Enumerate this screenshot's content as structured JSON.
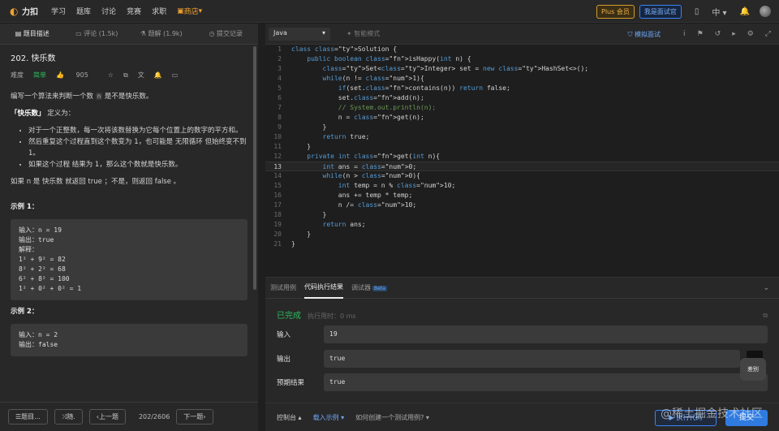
{
  "topbar": {
    "logo": "力扣",
    "nav": [
      "学习",
      "题库",
      "讨论",
      "竞赛",
      "求职"
    ],
    "store": "商店",
    "plus": "Plus 会员",
    "interview": "我是面试官",
    "lang": "中"
  },
  "left": {
    "tabs": [
      "题目描述",
      "评论 (1.5k)",
      "题解 (1.9k)",
      "提交记录"
    ],
    "problem_title": "202. 快乐数",
    "difficulty_label": "难度",
    "difficulty": "简单",
    "likes": "905",
    "desc1_a": "编写一个算法来判断一个数 ",
    "desc1_code": "n",
    "desc1_b": " 是不是快乐数。",
    "def_bold": "「快乐数」",
    "def_rest": " 定义为：",
    "bullets": [
      "对于一个正整数，每一次将该数替换为它每个位置上的数字的平方和。",
      "然后重复这个过程直到这个数变为 1，也可能是 无限循环 但始终变不到 1。",
      "如果这个过程 结果为 1，那么这个数就是快乐数。"
    ],
    "desc2": "如果 n 是 快乐数 就返回 true ；不是，则返回 false 。",
    "ex1_title": "示例 1：",
    "ex1_lines": [
      "输入：n = 19",
      "输出：true",
      "解释：",
      "1² + 9² = 82",
      "8² + 2² = 68",
      "6² + 8² = 100",
      "1² + 0² + 0² = 1"
    ],
    "ex2_title": "示例 2：",
    "ex2_lines": [
      "输入：n = 2",
      "输出：false"
    ],
    "bottom": {
      "list": "题目...",
      "random": "随.",
      "prev": "上一题",
      "page": "202/2606",
      "next": "下一题"
    }
  },
  "editor": {
    "language": "Java",
    "mode": "智能模式",
    "mock": "模拟面试",
    "code_lines": [
      "class Solution {",
      "    public boolean isHappy(int n) {",
      "        Set<Integer> set = new HashSet<>();",
      "        while(n != 1){",
      "            if(set.contains(n)) return false;",
      "            set.add(n);",
      "            // System.out.println(n);",
      "            n = get(n);",
      "        }",
      "        return true;",
      "    }",
      "    private int get(int n){",
      "        int ans = 0;",
      "        while(n > 0){",
      "            int temp = n % 10;",
      "            ans += temp * temp;",
      "            n /= 10;",
      "        }",
      "        return ans;",
      "    }",
      "}"
    ]
  },
  "console": {
    "tabs": [
      "测试用例",
      "代码执行结果",
      "调试器"
    ],
    "beta": "Beta",
    "status": "已完成",
    "time": "执行用时：0 ms",
    "input_label": "输入",
    "input_value": "19",
    "output_label": "输出",
    "output_value": "true",
    "expected_label": "预期结果",
    "expected_value": "true",
    "diff_label": "差别"
  },
  "footer": {
    "console": "控制台",
    "load_example": "载入示例",
    "help": "如何创建一个测试用例?",
    "run": "执行代码",
    "submit": "提交",
    "watermark": "@稀土掘金技术社区"
  }
}
